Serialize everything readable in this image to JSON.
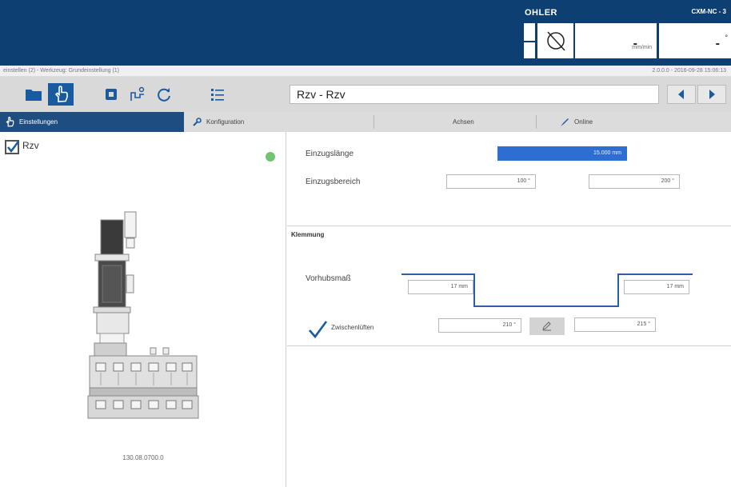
{
  "header": {
    "logo": "OHLER",
    "machine_name": "CXM-NC - 3",
    "speed": {
      "value": "-",
      "unit": "mm/min"
    },
    "angle": {
      "value": "-",
      "unit": "°"
    }
  },
  "infobar": {
    "left": "einstellen (2) - Werkzeug: Grundeinstellung (1)",
    "right": "2.0.0.0 - 2016-09-28 15:06:13"
  },
  "toolbar": {
    "title": "Rzv - Rzv"
  },
  "tabs": [
    {
      "label": "Einstellungen",
      "icon": "hand-icon"
    },
    {
      "label": "Konfiguration",
      "icon": "wrench-icon"
    },
    {
      "label": "Achsen"
    },
    {
      "label": "Online",
      "icon": "brush-icon"
    }
  ],
  "left_panel": {
    "title": "Rzv",
    "checked": true,
    "status_color": "#72c472",
    "part_number": "130.08.0700.0"
  },
  "settings": {
    "einzugslaenge": {
      "label": "Einzugslänge",
      "value": "15.000 mm"
    },
    "einzugsbereich": {
      "label": "Einzugsbereich",
      "value_from": "100 °",
      "value_to": "200 °"
    },
    "klemmung": {
      "title": "Klemmung",
      "vorhubsmass": {
        "label": "Vorhubsmaß",
        "value_left": "17 mm",
        "value_right": "17 mm"
      },
      "zwischenlueften": {
        "label": "Zwischenlüften",
        "checked": true,
        "value_from": "210 °",
        "value_to": "215 °"
      }
    }
  },
  "colors": {
    "header": "#0d3f73",
    "active_blue": "#1e4d82",
    "field_blue": "#2e6dd1",
    "graph_line": "#2b5fa8"
  }
}
